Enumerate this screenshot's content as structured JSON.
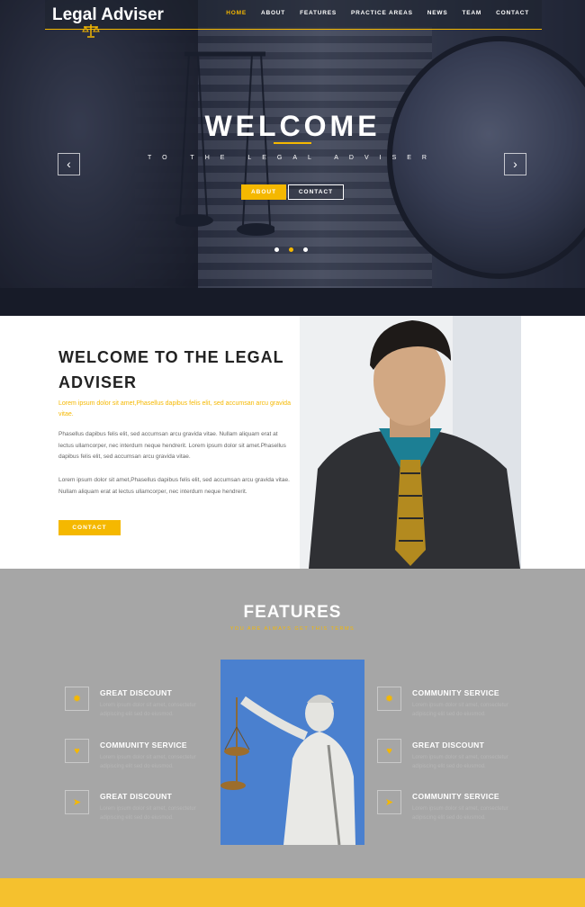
{
  "brand": {
    "name": "Legal Adviser",
    "accent": "#f5b800"
  },
  "nav": {
    "items": [
      "HOME",
      "ABOUT",
      "FEATURES",
      "PRACTICE AREAS",
      "NEWS",
      "TEAM",
      "CONTACT"
    ],
    "active": "HOME"
  },
  "hero": {
    "title": "WELCOME",
    "subtitle": "TO THE LEGAL ADVISER",
    "about_button": "ABOUT",
    "contact_button": "CONTACT",
    "prev_arrow": "‹",
    "next_arrow": "›",
    "slide_count": 3,
    "active_slide": 2
  },
  "about": {
    "title": "WELCOME TO THE LEGAL ADVISER",
    "highlight": "Lorem ipsum dolor sit amet,Phasellus dapibus felis elit, sed accumsan arcu gravida vitae.",
    "paragraph1": "Phasellus dapibus felis elit, sed accumsan arcu gravida vitae. Nullam aliquam erat at lectus ullamcorper, nec interdum neque hendrerit. Lorem ipsum dolor sit amet.Phasellus dapibus felis elit, sed accumsan arcu gravida vitae.",
    "paragraph2": "Lorem ipsum dolor sit amet,Phasellus dapibus felis elit, sed accumsan arcu gravida vitae. Nullam aliquam erat at lectus ullamcorper, nec interdum neque hendrerit.",
    "button": "CONTACT"
  },
  "features": {
    "title": "FEATURES",
    "subtitle": "YOU ARE ALWAYS GET THIS TERMS",
    "left": [
      {
        "name": "GREAT DISCOUNT",
        "icon": "gear-icon",
        "desc": "Lorem ipsum dolor sit amet, consectetur adipiscing elit sed do eiusmod."
      },
      {
        "name": "COMMUNITY SERVICE",
        "icon": "heart-icon",
        "desc": "Lorem ipsum dolor sit amet, consectetur adipiscing elit sed do eiusmod."
      },
      {
        "name": "GREAT DISCOUNT",
        "icon": "send-icon",
        "desc": "Lorem ipsum dolor sit amet, consectetur adipiscing elit sed do eiusmod."
      }
    ],
    "right": [
      {
        "name": "COMMUNITY SERVICE",
        "icon": "gear-icon",
        "desc": "Lorem ipsum dolor sit amet, consectetur adipiscing elit sed do eiusmod."
      },
      {
        "name": "GREAT DISCOUNT",
        "icon": "heart-icon",
        "desc": "Lorem ipsum dolor sit amet, consectetur adipiscing elit sed do eiusmod."
      },
      {
        "name": "COMMUNITY SERVICE",
        "icon": "send-icon",
        "desc": "Lorem ipsum dolor sit amet, consectetur adipiscing elit sed do eiusmod."
      }
    ]
  },
  "icons": {
    "gear-icon": "✹",
    "heart-icon": "♥",
    "send-icon": "➤"
  }
}
